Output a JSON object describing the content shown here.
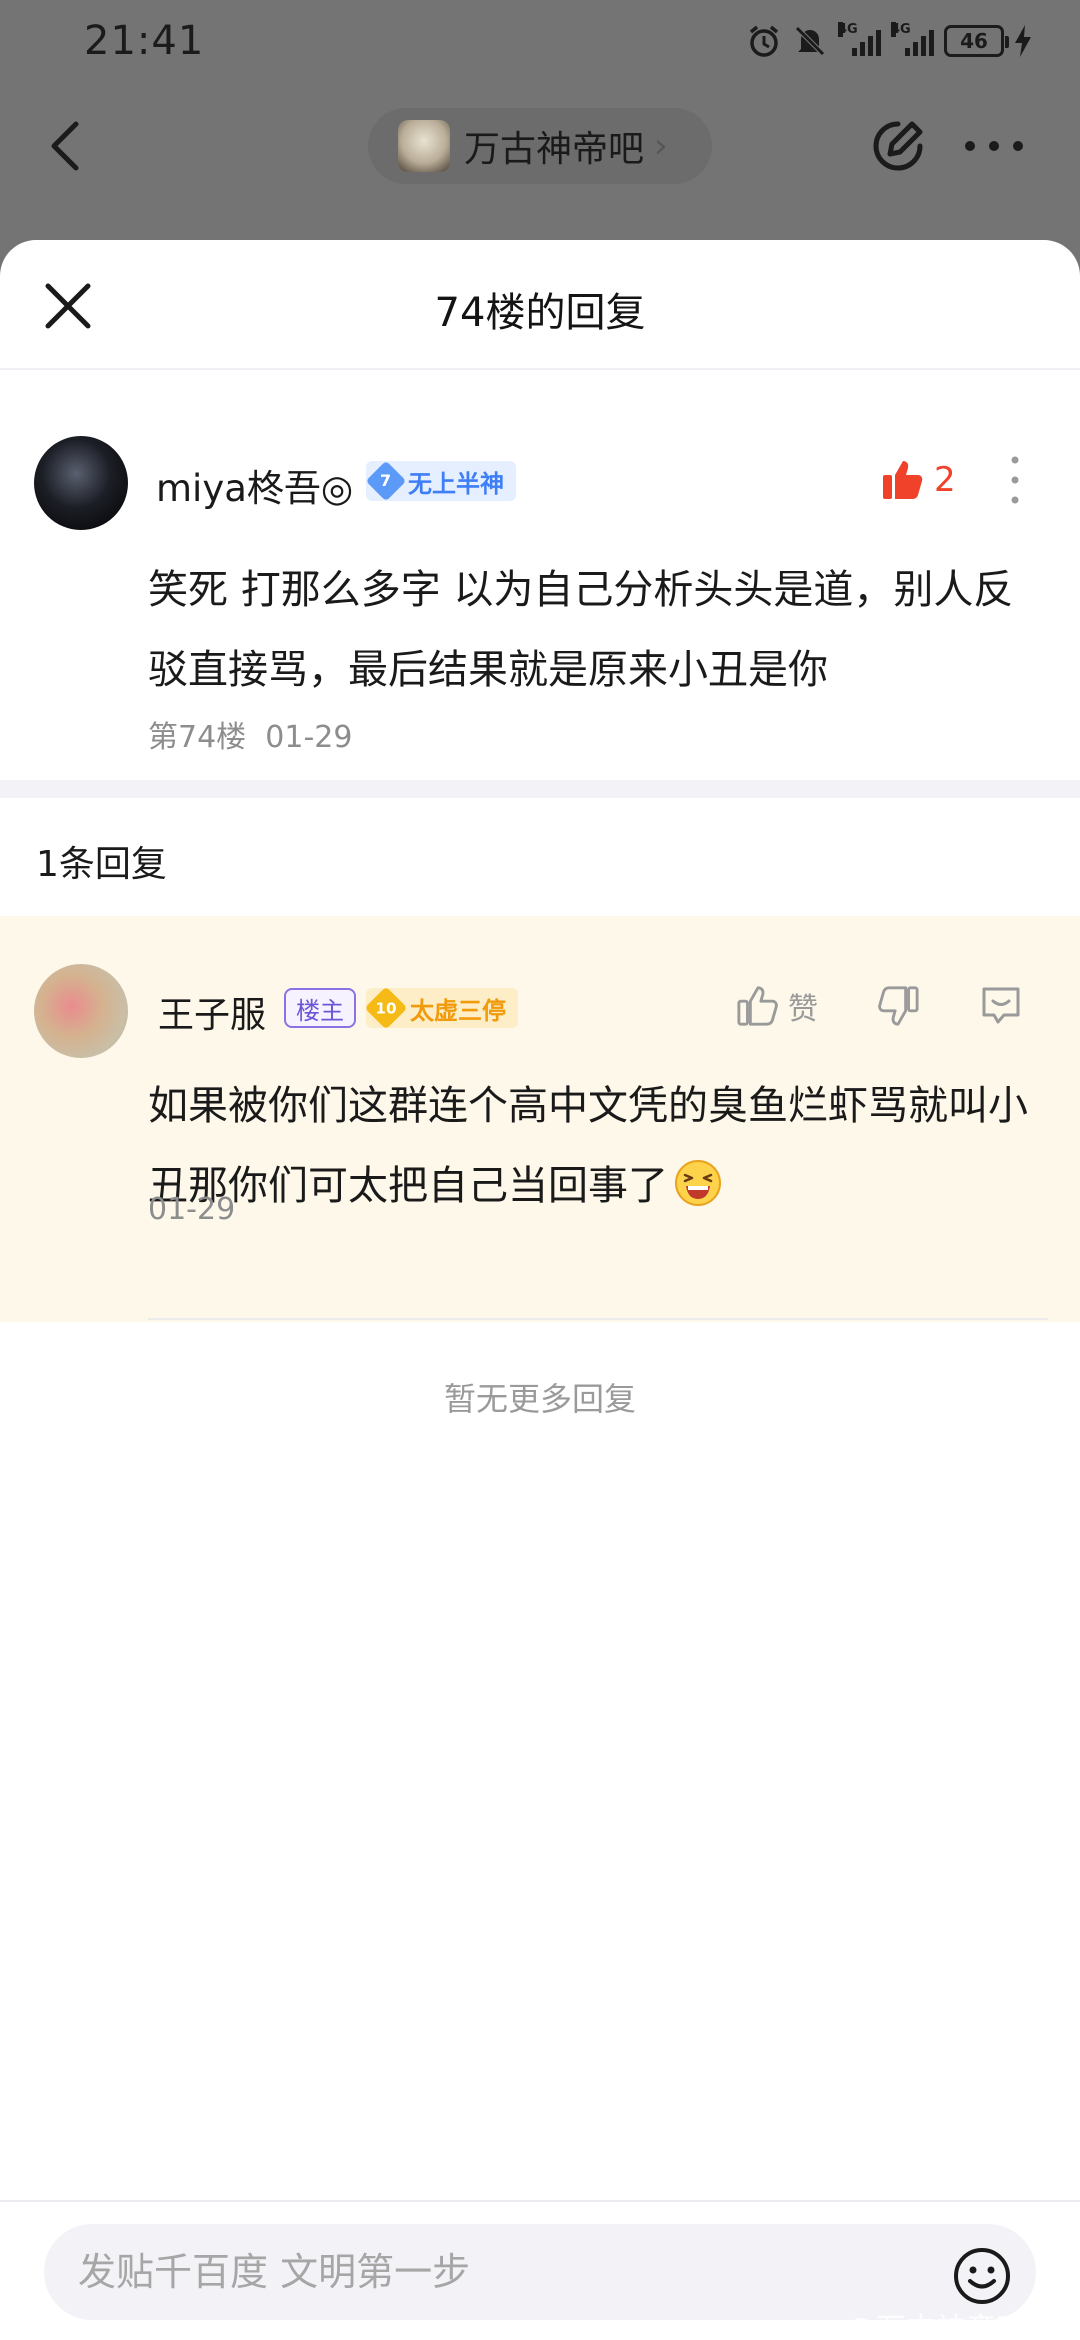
{
  "status_bar": {
    "time": "21:41",
    "net1": "4G",
    "net2": "4G",
    "battery": "46"
  },
  "nav": {
    "forum_name": "万古神帝吧",
    "back_icon": "chevron-left-icon",
    "edit_icon": "edit-share-icon",
    "more_icon": "more-horizontal-icon"
  },
  "sheet": {
    "title": "74楼的回复"
  },
  "main_post": {
    "username": "miya柊吾◎",
    "level_number": "7",
    "level_title": "无上半神",
    "like_count": "2",
    "content": "笑死 打那么多字 以为自己分析头头是道，别人反驳直接骂，最后结果就是原来小丑是你",
    "floor": "第74楼",
    "date": "01-29"
  },
  "replies_header": "1条回复",
  "reply": {
    "username": "王子服",
    "host_tag": "楼主",
    "level_number": "10",
    "level_title": "太虚三停",
    "like_label": "赞",
    "content": "如果被你们这群连个高中文凭的臭鱼烂虾骂就叫小丑那你们可太把自己当回事了",
    "date": "01-29"
  },
  "no_more": "暂无更多回复",
  "input": {
    "placeholder": "发贴千百度 文明第一步"
  },
  "watermark": "@万古神帝吧",
  "colors": {
    "like_red": "#f0412a",
    "level_blue": "#5c9af8",
    "level_gold": "#f6ba16",
    "host_purple": "#6d55d6",
    "reply_bg": "#fdf8ea"
  }
}
